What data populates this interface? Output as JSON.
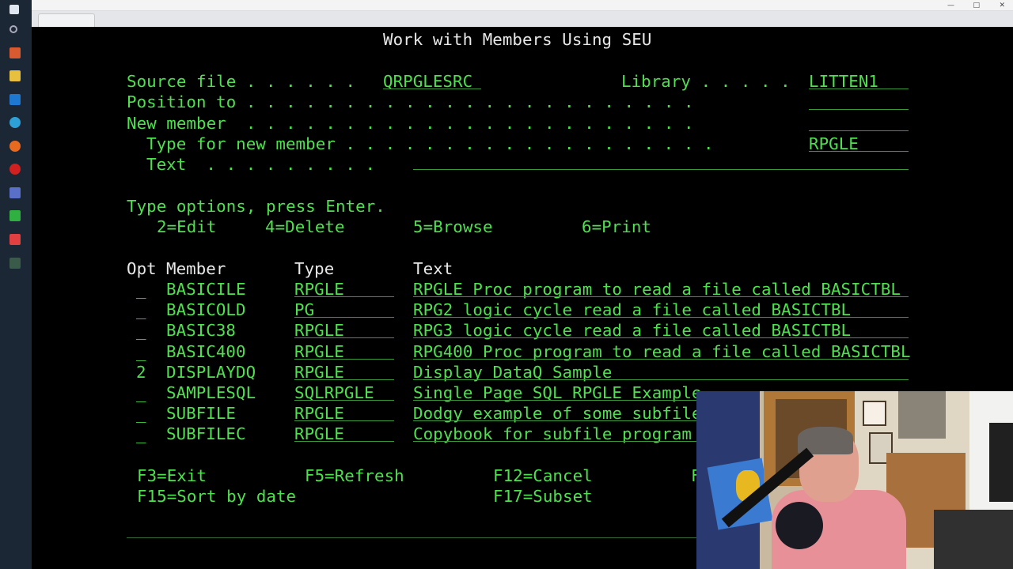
{
  "screen": {
    "title": "Work with Members Using SEU",
    "source_file_label": "Source file . . . . . .",
    "source_file_value": "QRPGLESRC",
    "library_label": "Library . . . . .",
    "library_value": "LITTEN1",
    "position_to_label": "Position to . . . . . . . . . . . . . . . . . . . . . . .",
    "position_to_value": "",
    "new_member_label": "New member  . . . . . . . . . . . . . . . . . . . . . . .",
    "new_member_value": "",
    "type_new_label": "Type for new member . . . . . . . . . . . . . . . . . . .",
    "type_new_value": "RPGLE",
    "text_label": "Text  . . . . . . . . .",
    "text_value": "",
    "instructions": "Type options, press Enter.",
    "options": [
      "2=Edit",
      "4=Delete",
      "5=Browse",
      "6=Print"
    ],
    "headers": {
      "opt": "Opt",
      "member": "Member",
      "type": "Type",
      "text": "Text"
    },
    "rows": [
      {
        "opt": "_",
        "member": "BASICILE",
        "type": "RPGLE",
        "text": "RPGLE Proc program to read a file called BASICTBL"
      },
      {
        "opt": "_",
        "member": "BASICOLD",
        "type": "PG",
        "text": "RPG2 logic cycle read a file called BASICTBL"
      },
      {
        "opt": "_",
        "member": "BASIC38",
        "type": "RPGLE",
        "text": "RPG3 logic cycle read a file called BASICTBL"
      },
      {
        "opt": "_",
        "member": "BASIC400",
        "type": "RPGLE",
        "text": "RPG400 Proc program to read a file called BASICTBL"
      },
      {
        "opt": "2",
        "member": "DISPLAYDQ",
        "type": "RPGLE",
        "text": "Display DataQ Sample"
      },
      {
        "opt": "_",
        "member": "SAMPLESQL",
        "type": "SQLRPGLE",
        "text": "Single Page SQL RPGLE Example"
      },
      {
        "opt": "_",
        "member": "SUBFILE",
        "type": "RPGLE",
        "text": "Dodgy example of some subfile"
      },
      {
        "opt": "_",
        "member": "SUBFILEC",
        "type": "RPGLE",
        "text": "Copybook for subfile program"
      }
    ],
    "fkeys_row1": [
      "F3=Exit",
      "F5=Refresh",
      "F12=Cancel",
      "F"
    ],
    "fkeys_row2": [
      "F15=Sort by date",
      "F17=Subset"
    ]
  },
  "colors": {
    "terminal_green": "#4fe04f",
    "heading_white": "#e8e8e8",
    "background": "#000000"
  },
  "webcam_overlay": "presenter-video"
}
